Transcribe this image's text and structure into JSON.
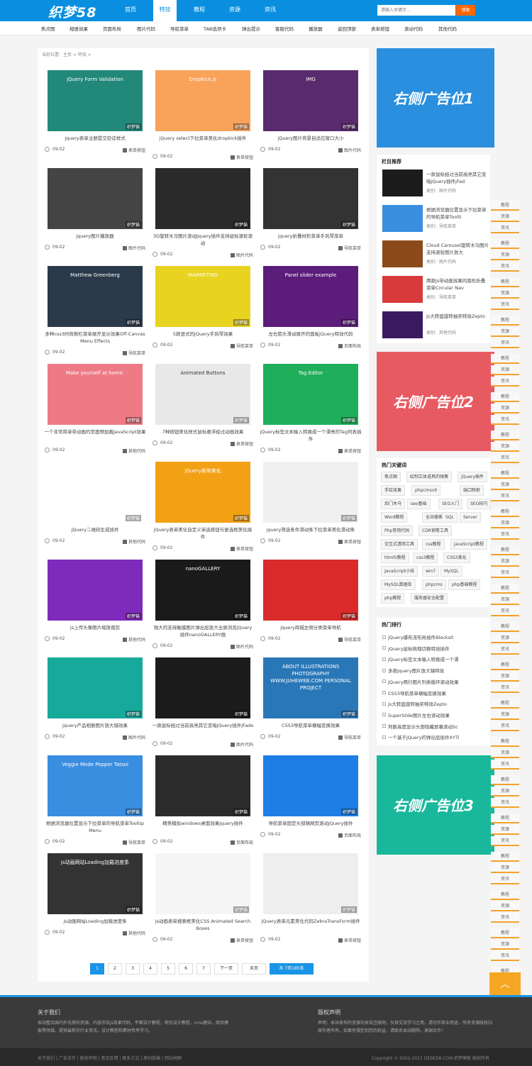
{
  "header": {
    "logo": "织梦58",
    "nav": [
      "首页",
      "特效",
      "教程",
      "资源",
      "资讯"
    ],
    "active_nav": 1,
    "search": {
      "placeholder": "请输入关键字...",
      "button": "搜索"
    }
  },
  "subnav": [
    "焦点图",
    "相册效果",
    "页面布局",
    "图片代码",
    "导航菜单",
    "TAB选项卡",
    "弹出提示",
    "客服代码",
    "播放器",
    "返回顶部",
    "表单按钮",
    "滚动代码",
    "其他代码"
  ],
  "breadcrumb": "当前位置：主页 > 特效 >",
  "watermark": "织梦猫",
  "cards": [
    {
      "title": "jquery表单注册提交验证样式",
      "date": "09-02",
      "cat": "表单按钮",
      "thumb_text": "jQuery Form Validation",
      "color": "#22887a"
    },
    {
      "title": "jQuery select下拉菜单美化dropkick插件",
      "date": "09-02",
      "cat": "表单按钮",
      "thumb_text": "DropKick.js",
      "color": "#f8a25a"
    },
    {
      "title": "jQuery图片背景自适应窗口大小",
      "date": "09-02",
      "cat": "图片代码",
      "thumb_text": "IMG",
      "color": "#5a2a6e"
    },
    {
      "title": "jquery图片播放器",
      "date": "09-02",
      "cat": "图片代码",
      "thumb_text": "",
      "color": "#444444"
    },
    {
      "title": "3D旋转木马图片滚动Jquery插件支持鼠标滚轮滚动",
      "date": "09-02",
      "cat": "图片代码",
      "thumb_text": "",
      "color": "#2a2a2a"
    },
    {
      "title": "jquery折叠树形菜单手风琴菜单",
      "date": "09-02",
      "cat": "导航菜单",
      "thumb_text": "",
      "color": "#333333"
    },
    {
      "title": "多种css3时尚侧栏菜单展开显示效果Off-Canvas Menu Effects",
      "date": "09-02",
      "cat": "导航菜单",
      "thumb_text": "Matthew Greenberg",
      "color": "#2b3a4a"
    },
    {
      "title": "5款竖式的jQuery手风琴效果",
      "date": "09-02",
      "cat": "导航菜单",
      "thumb_text": "MARKETING",
      "color": "#e8d320"
    },
    {
      "title": "左右箭头滑动展开的面板jQuery特效代码",
      "date": "09-02",
      "cat": "页面布局",
      "thumb_text": "Panel slider example",
      "color": "#5c1d7a"
    },
    {
      "title": "一个非常简单带动画的页面预加载JavaScript效果",
      "date": "09-02",
      "cat": "其他代码",
      "thumb_text": "Make yourself at home.",
      "color": "#ee7a85"
    },
    {
      "title": "7种按钮美化样式鼠标悬浮经过动画效果",
      "date": "09-02",
      "cat": "表单按钮",
      "thumb_text": "Animated Buttons",
      "color": "#e8e8e8"
    },
    {
      "title": "jQuery标签文本输入转换成一个漂亮的Tag列表插件",
      "date": "09-02",
      "cat": "表单按钮",
      "thumb_text": "Tag Editor",
      "color": "#1fae5a"
    },
    {
      "title": "jQuery二维码生成插件",
      "date": "09-02",
      "cat": "其他代码",
      "thumb_text": "",
      "color": "#ffffff"
    },
    {
      "title": "jQuery表单美化自定义单选按钮与复选框美化插件",
      "date": "09-02",
      "cat": "表单按钮",
      "thumb_text": "jQuery表单美化",
      "color": "#f2a014"
    },
    {
      "title": "jquery筛选条件滑动条下拉菜单美化滑动条",
      "date": "09-02",
      "cat": "表单按钮",
      "thumb_text": "",
      "color": "#f0f0f0"
    },
    {
      "title": "js上传头像图片缩放裁剪",
      "date": "09-02",
      "cat": "其他代码",
      "thumb_text": "",
      "color": "#7e2bbb"
    },
    {
      "title": "强大的支持触摸图片弹出层放大全屏浏览jQuery插件nanoGALLERY画",
      "date": "09-02",
      "cat": "图片代码",
      "thumb_text": "nanoGALLERY",
      "color": "#1a1a1a"
    },
    {
      "title": "jquery商城左侧分类菜单导航",
      "date": "09-02",
      "cat": "导航菜单",
      "thumb_text": "",
      "color": "#d92b2b"
    },
    {
      "title": "jquery产品相册图片放大镜效果",
      "date": "09-02",
      "cat": "图片代码",
      "thumb_text": "",
      "color": "#17a99b"
    },
    {
      "title": "一款鼠标经过当前高亮其它变暗jQuery插件jFade",
      "date": "09-02",
      "cat": "图片代码",
      "thumb_text": "",
      "color": "#1c1c1c"
    },
    {
      "title": "CSS3导航菜单横幅变换效果",
      "date": "09-02",
      "cat": "导航菜单",
      "thumb_text": "ABOUT ILLUSTRATIONS PHOTOGRAPHY WWW.JUHEWEB.COM PERSONAL PROJECT",
      "color": "#2a77b8"
    },
    {
      "title": "根据浏览器位置显示下拉菜单的导航菜单Tooltip Menu",
      "date": "09-02",
      "cat": "导航菜单",
      "thumb_text": "Veggie Mode   Pepper Tatsoi",
      "color": "#3a8ee0"
    },
    {
      "title": "精美模拟windows桌面效果jquery插件",
      "date": "09-02",
      "cat": "页面布局",
      "thumb_text": "",
      "color": "#2b2b2b"
    },
    {
      "title": "导航菜单固定头部随网页滚动jQuery插件",
      "date": "09-02",
      "cat": "页面布局",
      "thumb_text": "",
      "color": "#1e7ee6"
    },
    {
      "title": "js动画网站Loading加载进度条",
      "date": "09-02",
      "cat": "其他代码",
      "thumb_text": "js动画网站Loading加载进度条",
      "color": "#333333"
    },
    {
      "title": "js动画表单搜索框美化CSS Animated Search Boxes",
      "date": "09-02",
      "cat": "表单按钮",
      "thumb_text": "",
      "color": "#f5f5f5"
    },
    {
      "title": "jQuery表单元素美化代码ZebraTransForm插件",
      "date": "09-02",
      "cat": "表单按钮",
      "thumb_text": "",
      "color": "#eeeeee"
    }
  ],
  "pager": [
    "1",
    "2",
    "3",
    "4",
    "5",
    "6",
    "7",
    "下一页",
    "末页",
    "共 7页185条"
  ],
  "ads": [
    "右侧广告位1",
    "右侧广告位2",
    "右侧广告位3"
  ],
  "ad_colors": [
    "#2a8fde",
    "#e85a62",
    "#19b89c"
  ],
  "recommend": {
    "title": "栏目推荐",
    "items": [
      {
        "title": "一款鼠标经过当前高亮其它变暗jQuery插件jFad",
        "cat": "类别：图片代码",
        "color": "#1c1c1c"
      },
      {
        "title": "根据浏览器位置显示下拉菜单的导航菜单Toolti",
        "cat": "类别：导航菜单",
        "color": "#3a8ee0"
      },
      {
        "title": "Cloud Carousel旋转木马图片支持滚轮图片放大",
        "cat": "类别：图片代码",
        "color": "#8a4a1a"
      },
      {
        "title": "两款js带动画效果的扇形折叠菜单Circular Nav",
        "cat": "类别：导航菜单",
        "color": "#d83a3a"
      },
      {
        "title": "js大转盘旋转抽奖特效Zepto",
        "cat": "类别：其他代码",
        "color": "#3a1a5e"
      }
    ]
  },
  "hot_tags": {
    "title": "热门关键词",
    "tags": [
      "焦点图",
      "绘制立体道具的弹簧",
      "jQuery插件",
      "手绘效果",
      "phpcmsv9",
      "端口映射",
      "后门木马",
      "seo基础",
      "SEO入门",
      "SEO技巧",
      "Word教程",
      "全站搜索",
      "SQL",
      "Server",
      "Php常用代码",
      "CDR钢笔工具",
      "交互式透明工具",
      "css教程",
      "javaScript教程",
      "html5教程",
      "css3教程",
      "CSS3美化",
      "JavaScript小技",
      "win7",
      "MySQL",
      "MySQL数据库",
      "phpcms",
      "php基础教程",
      "php教程",
      "服务器安全配置"
    ]
  },
  "hot_rank": {
    "title": "热门排行",
    "items": [
      "jQuery爆布流布局插件Blockslt",
      "jQuery鼠标拖拽切换特效插件",
      "jQuery标签文本输入转换成一个漂",
      "多款jquery图片放大镜特效",
      "jQuery两行图片列表循环滚动效果",
      "CSS3导航菜单横幅变换效果",
      "js大转盘旋转抽奖特效Zepto",
      "SuperSlide图片左右滚动效果",
      "判断高度显示头部隐藏屏幕滚动Sc",
      "一个基于jQuery的弹出层插件XYTi"
    ]
  },
  "float_tabs": [
    "教程",
    "资源",
    "资讯"
  ],
  "totop": "︿",
  "footer": {
    "about_title": "关于我们",
    "about_text": "本站整合国内外优质的资源，内容涉及js效果代码，平面设计教程，网页设计教程，cms建站，网页模板等领域，提供最新的行业资讯，设计教程和素材参考学习。",
    "copyright_title": "版权声明",
    "copyright_text": "声明：本站发布的资源均来自互联网，仅供交流学习之用，请勿作商业用途，所有资源版权归原作者所有。如果有侵犯到您的权益，请联系本站删除，谢谢合作！",
    "links": "关于我们 | 广告合作 | 版权声明 | 意见反馈 | 联系方式 | 原创投稿 | 网站地图",
    "copy": "Copyright © 2002-2011 DEDE58.COM 织梦模板 版权所有"
  }
}
